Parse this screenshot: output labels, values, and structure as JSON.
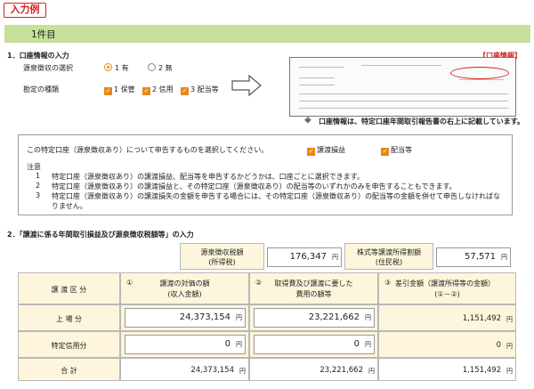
{
  "header": {
    "tag": "入力例",
    "section_title": "1件目"
  },
  "account_info": {
    "heading": "1．口座情報の入力",
    "ref_label": "【口座情報】",
    "withholding": {
      "label": "源泉徴収の選択",
      "options": [
        "1 有",
        "2 無"
      ],
      "selected": "1 有"
    },
    "account_type": {
      "label": "勘定の種類",
      "options": [
        "1 保管",
        "2 信用",
        "3 配当等"
      ],
      "checked": [
        "1 保管",
        "2 信用",
        "3 配当等"
      ]
    },
    "note_mark": "※",
    "note": "口座情報は、特定口座年間取引報告書の右上に記載しています。"
  },
  "notice_box": {
    "question": "この特定口座（源泉徴収あり）について申告するものを選択してください。",
    "choices": [
      "譲渡損益",
      "配当等"
    ],
    "caution_title": "注意",
    "cautions": [
      {
        "no": "1",
        "text": "特定口座（源泉徴収あり）の譲渡損益、配当等を申告するかどうかは、口座ごとに選択できます。"
      },
      {
        "no": "2",
        "text": "特定口座（源泉徴収あり）の譲渡損益と、その特定口座（源泉徴収あり）の配当等のいずれかのみを申告することもできます。"
      },
      {
        "no": "3",
        "text": "特定口座（源泉徴収あり）の譲渡損失の金額を申告する場合には、その特定口座（源泉徴収あり）の配当等の金額を併せて申告しなければな"
      },
      {
        "no": "",
        "text": "りません。"
      }
    ]
  },
  "transfer": {
    "heading": "2．「譲渡に係る年間取引損益及び源泉徴収税額等」の入力",
    "tax1_label": [
      "源泉徴収税額",
      "(所得税)"
    ],
    "tax1_value": "176,347",
    "tax2_label": [
      "株式等譲渡所得割額",
      "(住民税)"
    ],
    "tax2_value": "57,571",
    "unit": "円",
    "col_header": "譲 渡 区 分",
    "columns": [
      {
        "no": "①",
        "lines": [
          "譲渡の対価の額",
          "(収入金額)"
        ]
      },
      {
        "no": "②",
        "lines": [
          "取得費及び譲渡に要した",
          "費用の額等"
        ]
      },
      {
        "no": "③",
        "lines": [
          "差引金額（譲渡所得等の金額）",
          "(①－②)"
        ]
      }
    ],
    "rows": [
      {
        "label": "上 場 分",
        "c1": "24,373,154",
        "c2": "23,221,662",
        "c3": "1,151,492"
      },
      {
        "label": "特定信用分",
        "c1": "0",
        "c2": "0",
        "c3": "0"
      },
      {
        "label": "合 計",
        "c1": "24,373,154",
        "c2": "23,221,662",
        "c3": "1,151,492"
      }
    ]
  }
}
